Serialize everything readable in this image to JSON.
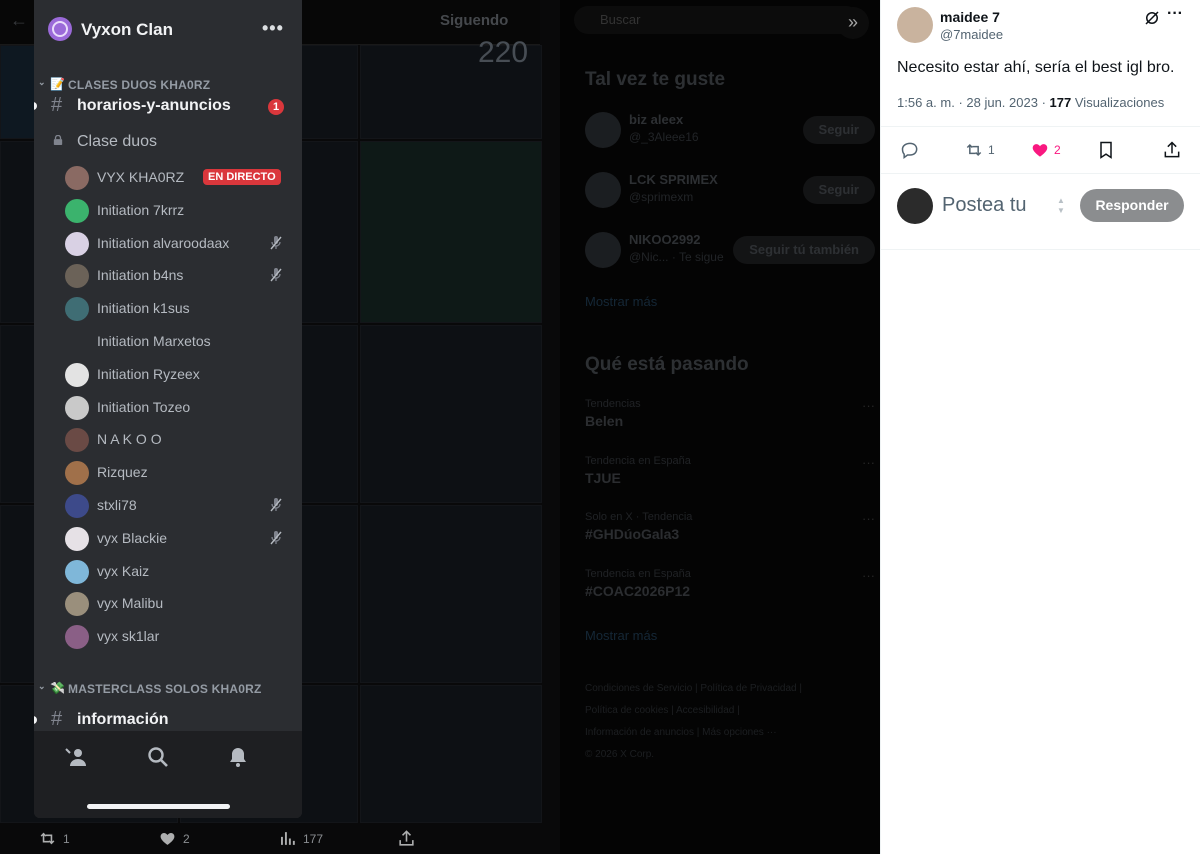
{
  "background": {
    "tab_following": "Siguendo",
    "big_number": "220",
    "search_placeholder": "Buscar",
    "suggest_title": "Tal vez te guste",
    "suggestions": [
      {
        "name": "biz aleex",
        "handle": "@_3Aleee16",
        "button": "Seguir"
      },
      {
        "name": "LCK SPRIMEX",
        "handle": "@sprimexm",
        "button": "Seguir"
      },
      {
        "name": "NIKOO2992",
        "handle": "@Nic... · Te sigue",
        "button": "Seguir tú también"
      }
    ],
    "show_more": "Mostrar más",
    "trends_title": "Qué está pasando",
    "trends": [
      {
        "context": "Tendencias",
        "topic": "Belen"
      },
      {
        "context": "Tendencia en España",
        "topic": "TJUE"
      },
      {
        "context": "Solo en X · Tendencia",
        "topic": "#GHDúoGala3"
      },
      {
        "context": "Tendencia en España",
        "topic": "#COAC2026P12"
      }
    ],
    "show_more_2": "Mostrar más",
    "footer_lines": [
      "Condiciones de Servicio | Política de Privacidad |",
      "Política de cookies | Accesibilidad |",
      "Información de anuncios | Más opciones ···",
      "© 2026 X Corp."
    ],
    "bottom_stats": {
      "retweets": "1",
      "likes": "2",
      "views": "177"
    }
  },
  "discord": {
    "server_name": "Vyxon Clan",
    "menu_glyph": "•••",
    "categories": [
      {
        "emoji": "📝",
        "label": "CLASES DUOS KHA0RZ"
      },
      {
        "emoji": "💸",
        "label": "MASTERCLASS SOLOS KHA0RZ"
      }
    ],
    "channels": [
      {
        "name": "horarios-y-anuncios",
        "badge": "1"
      },
      {
        "name": "información"
      }
    ],
    "voice_channel": "Clase duos",
    "live_label": "EN DIRECTO",
    "members": [
      {
        "name": "VYX KHA0RZ",
        "color": "#8a6a63",
        "live": true,
        "muted": false
      },
      {
        "name": "Initiation 7krrz",
        "color": "#3bb36d",
        "live": false,
        "muted": false
      },
      {
        "name": "Initiation alvaroodaax",
        "color": "#d9d1e4",
        "live": false,
        "muted": true
      },
      {
        "name": "Initiation b4ns",
        "color": "#6b6258",
        "live": false,
        "muted": true
      },
      {
        "name": "Initiation k1sus",
        "color": "#3f6d74",
        "live": false,
        "muted": false
      },
      {
        "name": "Initiation Marxetos",
        "color": "",
        "live": false,
        "muted": false
      },
      {
        "name": "Initiation Ryzeex",
        "color": "#e3e3e3",
        "live": false,
        "muted": false
      },
      {
        "name": "Initiation Tozeo",
        "color": "#c9c9c9",
        "live": false,
        "muted": false
      },
      {
        "name": "N A K O O",
        "color": "#6a4a45",
        "live": false,
        "muted": false
      },
      {
        "name": "Rizquez",
        "color": "#a0704a",
        "live": false,
        "muted": false
      },
      {
        "name": "stxli78",
        "color": "#3d4a8a",
        "live": false,
        "muted": true
      },
      {
        "name": "vyx Blackie",
        "color": "#e6e1e6",
        "live": false,
        "muted": true
      },
      {
        "name": "vyx Kaiz",
        "color": "#7fb7d9",
        "live": false,
        "muted": false
      },
      {
        "name": "vyx Malibu",
        "color": "#9a8f7c",
        "live": false,
        "muted": false
      },
      {
        "name": "vyx sk1lar",
        "color": "#8a5f86",
        "live": false,
        "muted": false
      }
    ],
    "bottom_nav": [
      "friends-icon",
      "search-icon",
      "bell-icon"
    ]
  },
  "tweet": {
    "author_name": "maidee 7",
    "author_handle": "@7maidee",
    "text": "Necesito estar ahí, sería el best igl bro.",
    "time": "1:56 a. m.",
    "date": "28 jun. 2023",
    "views_count": "177",
    "views_label": "Visualizaciones",
    "retweets": "1",
    "likes": "2",
    "like_color": "#f91880",
    "reply_placeholder": "Postea tu",
    "reply_button": "Responder"
  }
}
